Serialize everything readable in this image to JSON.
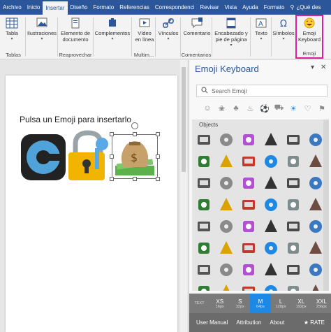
{
  "tabs": [
    "Archivo",
    "Inicio",
    "Insertar",
    "Diseño",
    "Formato",
    "Referencias",
    "Correspondenci",
    "Revisar",
    "Vista",
    "Ayuda",
    "Formato",
    "¿Qué des"
  ],
  "active_tab": "Insertar",
  "ribbon": {
    "tabla": "Tabla",
    "tablas_group": "Tablas",
    "ilustraciones": "Ilustraciones",
    "elemento": "Elemento de documento",
    "reaprovechar_group": "Reaprovechar",
    "complementos": "Complementos",
    "video": "Vídeo en línea",
    "multimedia_group": "Multim...",
    "vinculos": "Vínculos",
    "comentario": "Comentario",
    "comentarios_group": "Comentarios",
    "encabezado": "Encabezado y pie de página",
    "texto": "Texto",
    "simbolos": "Símbolos",
    "emoji_keyboard": "Emoji Keyboard",
    "emoji_group": "Emoji"
  },
  "document": {
    "text": "Pulsa un Emoji para insertarlo"
  },
  "pane": {
    "title": "Emoji Keyboard",
    "search_placeholder": "Search Emoji",
    "section": "Objects",
    "sizes": [
      {
        "label": "",
        "sub": "TEXT"
      },
      {
        "label": "XS",
        "sub": "16px"
      },
      {
        "label": "S",
        "sub": "32px"
      },
      {
        "label": "M",
        "sub": "64px"
      },
      {
        "label": "L",
        "sub": "128px"
      },
      {
        "label": "XL",
        "sub": "192px"
      },
      {
        "label": "XXL",
        "sub": "256px"
      }
    ],
    "active_size": "M",
    "footer": [
      "User Manual",
      "Attribution",
      "About",
      "RATE"
    ]
  },
  "colors": {
    "ribbon_blue": "#2b579a",
    "accent_blue": "#1e88e5",
    "highlight_magenta": "#d6239b"
  },
  "emoji_grid": [
    "joystick-icon",
    "pager-icon",
    "mobile-phone-icon",
    "calculator-icon",
    "phone-icon",
    "laptop-icon",
    "floppy-disk-icon",
    "cd-icon",
    "dvd-icon",
    "camera-icon",
    "camera-flash-icon",
    "video-camera-icon",
    "projector-icon",
    "film-camera-icon",
    "film-reel-icon",
    "film-strip-icon",
    "telephone-receiver-icon",
    "television-icon",
    "pager-green-icon",
    "fax-icon",
    "radio-icon",
    "microphone-icon",
    "stopwatch-icon",
    "alarm-clock-icon",
    "satellite-dish-icon",
    "clock-icon",
    "timer-icon",
    "compass-icon",
    "hourglass-icon",
    "level-icon",
    "hourglass-flowing-icon",
    "satellite-icon",
    "plug-icon",
    "battery-icon",
    "light-bulb-icon",
    "flashlight-icon",
    "candle-icon",
    "wastebasket-icon",
    "oil-drum-icon",
    "money-bag-icon",
    "dollar-icon",
    "yen-icon",
    "euro-icon",
    "pound-icon",
    "money-wings-icon",
    "credit-card-icon",
    "gem-icon",
    "balance-icon"
  ]
}
